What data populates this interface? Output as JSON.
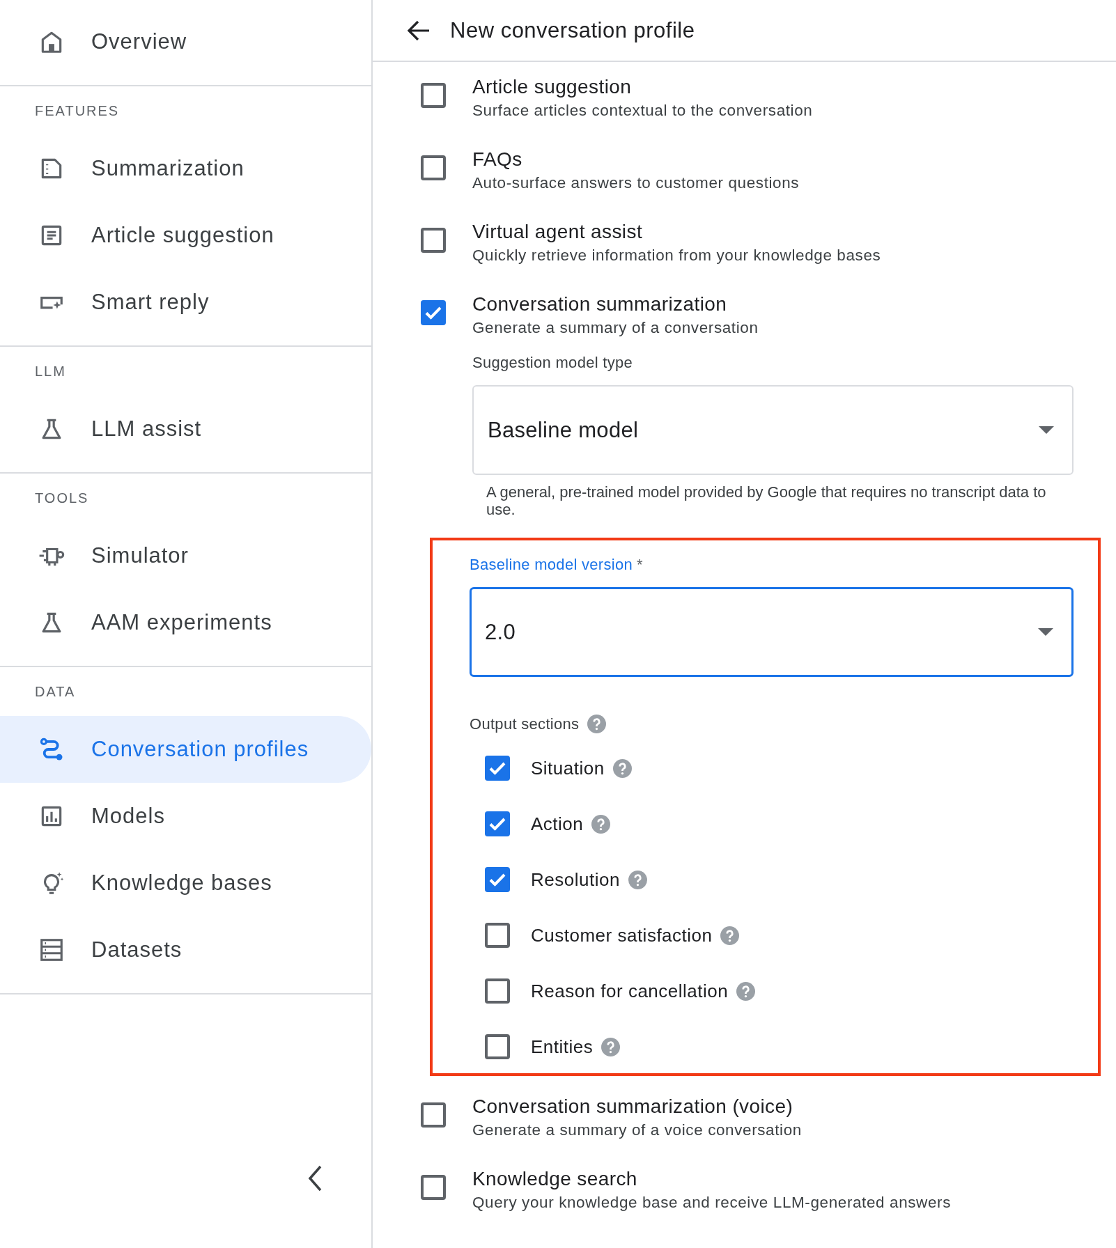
{
  "sidebar": {
    "items": [
      {
        "label": "Overview",
        "selected": false
      }
    ],
    "sections": [
      {
        "heading": "FEATURES",
        "items": [
          {
            "label": "Summarization",
            "selected": false
          },
          {
            "label": "Article suggestion",
            "selected": false
          },
          {
            "label": "Smart reply",
            "selected": false
          }
        ]
      },
      {
        "heading": "LLM",
        "items": [
          {
            "label": "LLM assist",
            "selected": false
          }
        ]
      },
      {
        "heading": "TOOLS",
        "items": [
          {
            "label": "Simulator",
            "selected": false
          },
          {
            "label": "AAM experiments",
            "selected": false
          }
        ]
      },
      {
        "heading": "DATA",
        "items": [
          {
            "label": "Conversation profiles",
            "selected": true
          },
          {
            "label": "Models",
            "selected": false
          },
          {
            "label": "Knowledge bases",
            "selected": false
          },
          {
            "label": "Datasets",
            "selected": false
          }
        ]
      }
    ]
  },
  "page": {
    "title": "New conversation profile",
    "features": [
      {
        "title": "Article suggestion",
        "description": "Surface articles contextual to the conversation",
        "checked": false
      },
      {
        "title": "FAQs",
        "description": "Auto-surface answers to customer questions",
        "checked": false
      },
      {
        "title": "Virtual agent assist",
        "description": "Quickly retrieve information from your knowledge bases",
        "checked": false
      },
      {
        "title": "Conversation summarization",
        "description": "Generate a summary of a conversation",
        "checked": true,
        "options": {
          "model_type": {
            "label": "Suggestion model type",
            "value": "Baseline model",
            "hint": "A general, pre-trained model provided by Google that requires no transcript data to use."
          },
          "highlighted": true,
          "model_version": {
            "label": "Baseline model version",
            "required_mark": "*",
            "value": "2.0",
            "focused": true
          },
          "output_sections": {
            "label": "Output sections",
            "items": [
              {
                "label": "Situation",
                "checked": true
              },
              {
                "label": "Action",
                "checked": true
              },
              {
                "label": "Resolution",
                "checked": true
              },
              {
                "label": "Customer satisfaction",
                "checked": false
              },
              {
                "label": "Reason for cancellation",
                "checked": false
              },
              {
                "label": "Entities",
                "checked": false
              }
            ]
          }
        }
      },
      {
        "title": "Conversation summarization (voice)",
        "description": "Generate a summary of a voice conversation",
        "checked": false
      },
      {
        "title": "Knowledge search",
        "description": "Query your knowledge base and receive LLM-generated answers",
        "checked": false
      }
    ]
  }
}
